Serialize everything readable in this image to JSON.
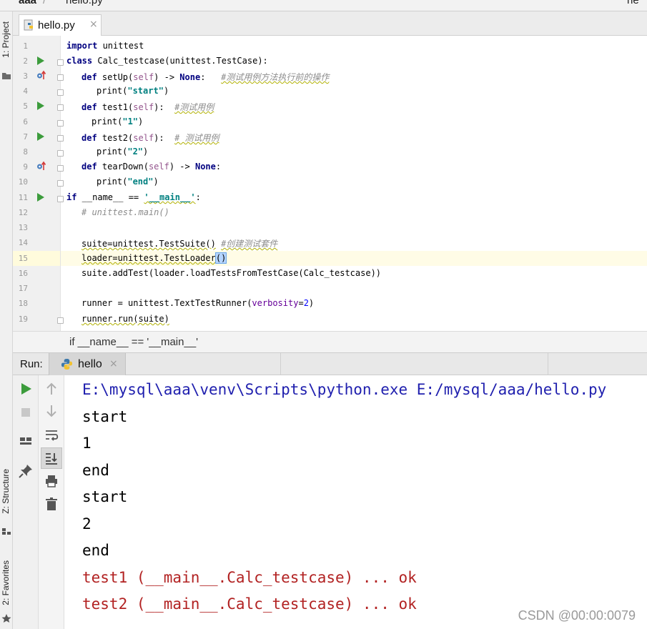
{
  "topbar": {
    "crumbs": [
      "aaa",
      "hello.py"
    ],
    "separator": "/",
    "right_fragment": "he"
  },
  "left_strip": {
    "project": "1: Project",
    "structure": "Z: Structure",
    "favorites": "2: Favorites"
  },
  "editor": {
    "tab": {
      "label": "hello.py",
      "close": "×",
      "icon": "python-file-icon"
    },
    "line_numbers": [
      "1",
      "2",
      "3",
      "4",
      "5",
      "6",
      "7",
      "8",
      "9",
      "10",
      "11",
      "12",
      "13",
      "14",
      "15",
      "16",
      "17",
      "18",
      "19"
    ],
    "lines": {
      "l1": {
        "kw": "import",
        "rest": " unittest"
      },
      "l2": {
        "kw": "class",
        "rest": " Calc_testcase(unittest.TestCase):"
      },
      "l3": {
        "kw": "def",
        "name": " setUp(",
        "self": "self",
        "mid": ") -> ",
        "none": "None",
        "colon": ":",
        "comment": "#测试用例方法执行前的操作"
      },
      "l4": {
        "call": "print(",
        "str": "\"start\"",
        "end": ")"
      },
      "l5": {
        "kw": "def",
        "name": " test1(",
        "self": "self",
        "mid": "):",
        "comment": "#测试用例"
      },
      "l6": {
        "call": "print(",
        "str": "\"1\"",
        "end": ")"
      },
      "l7": {
        "kw": "def",
        "name": " test2(",
        "self": "self",
        "mid": "):",
        "comment": "# 测试用例"
      },
      "l8": {
        "call": "print(",
        "str": "\"2\"",
        "end": ")"
      },
      "l9": {
        "kw": "def",
        "name": " tearDown(",
        "self": "self",
        "mid": ") -> ",
        "none": "None",
        "colon": ":"
      },
      "l10": {
        "call": "print(",
        "str": "\"end\"",
        "end": ")"
      },
      "l11": {
        "kw": "if",
        "pre": " __name__ == ",
        "str": "'__main__'",
        "colon": ":"
      },
      "l12": {
        "comment": "# unittest.main()"
      },
      "l14": {
        "code": "suite=unittest.TestSuite()",
        "comment": "#创建测试套件"
      },
      "l15": {
        "code": "loader=unittest.TestLoader",
        "paren": "()"
      },
      "l16": {
        "code": "suite.addTest(loader.loadTestsFromTestCase(Calc_testcase))"
      },
      "l18": {
        "pre": "runner = unittest.TextTestRunner(",
        "param": "verbosity",
        "eq": "=",
        "num": "2",
        "end": ")"
      },
      "l19": {
        "code": "runner.run(suite)"
      }
    }
  },
  "breadcrumb": {
    "text": "if __name__ == '__main__'"
  },
  "run": {
    "label": "Run:",
    "tab": {
      "label": "hello",
      "close": "×"
    },
    "console": [
      {
        "text": "E:\\mysql\\aaa\\venv\\Scripts\\python.exe E:/mysql/aaa/hello.py",
        "color": "#1f1fae"
      },
      {
        "text": "start",
        "color": "#000000"
      },
      {
        "text": "1",
        "color": "#000000"
      },
      {
        "text": "end",
        "color": "#000000"
      },
      {
        "text": "start",
        "color": "#000000"
      },
      {
        "text": "2",
        "color": "#000000"
      },
      {
        "text": "end",
        "color": "#000000"
      },
      {
        "text": "test1 (__main__.Calc_testcase) ... ok",
        "color": "#b22222"
      },
      {
        "text": "test2 (__main__.Calc_testcase) ... ok",
        "color": "#b22222"
      }
    ]
  },
  "watermark": "CSDN @00:00:0079",
  "colors": {
    "keyword": "#000080",
    "self": "#94558d",
    "comment": "#8c8c8c",
    "string": "#008080",
    "number": "#0000ff",
    "run_green": "#3c9c3c",
    "stderr": "#b22222",
    "command": "#1f1fae"
  }
}
